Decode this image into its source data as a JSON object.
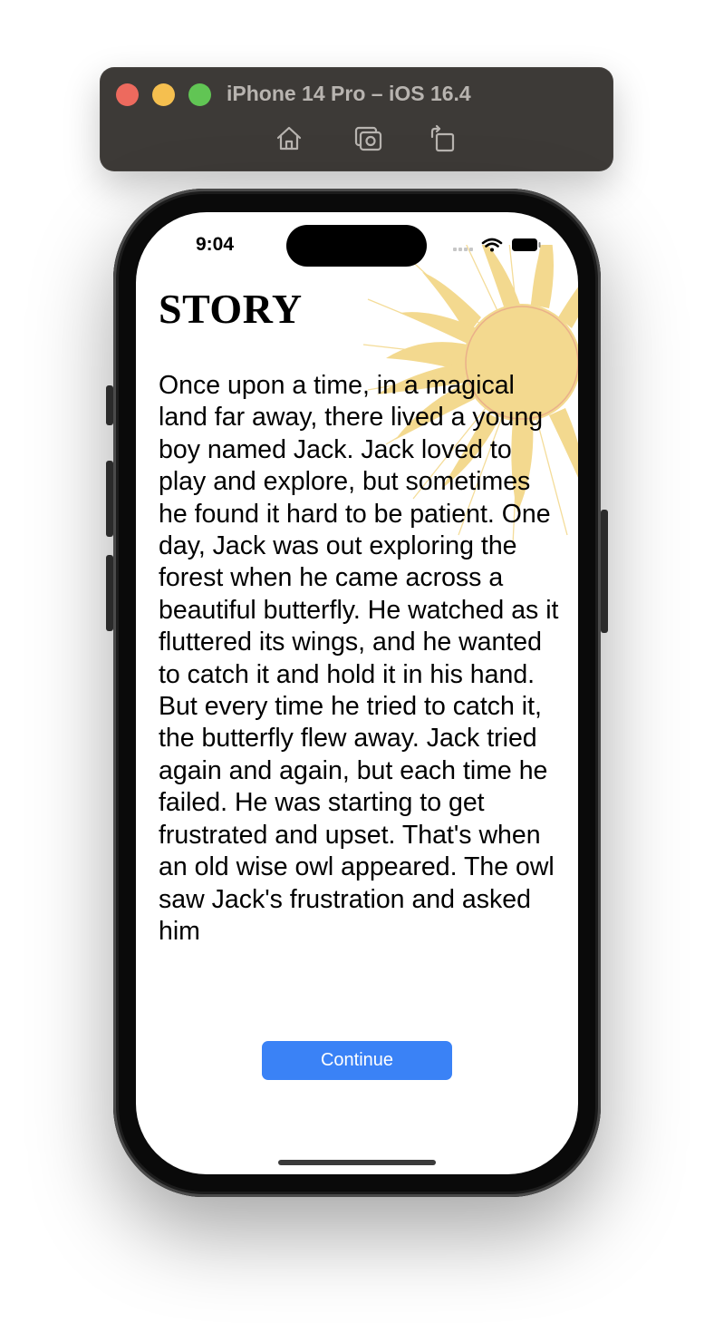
{
  "simulator": {
    "title": "iPhone 14 Pro – iOS 16.4",
    "toolbar_icons": [
      "home-icon",
      "screenshot-icon",
      "rotate-icon"
    ]
  },
  "status_bar": {
    "time": "9:04",
    "icons": [
      "cellular-signal-icon",
      "wifi-icon",
      "battery-icon"
    ]
  },
  "story": {
    "title": "STORY",
    "body": "Once upon a time, in a magical land far away, there lived a young boy named Jack. Jack loved to play and explore, but sometimes he found it hard to be patient. One day, Jack was out exploring the forest when he came across a beautiful butterfly. He watched as it fluttered its wings, and he wanted to catch it and hold it in his hand. But every time he tried to catch it, the butterfly flew away. Jack tried again and again, but each time he failed. He was starting to get frustrated and upset. That's when an old wise owl appeared. The owl saw Jack's frustration and asked him"
  },
  "actions": {
    "continue_label": "Continue"
  },
  "colors": {
    "accent": "#3a82f6",
    "sun": "#f3d98f",
    "toolbar": "#3d3a37"
  }
}
